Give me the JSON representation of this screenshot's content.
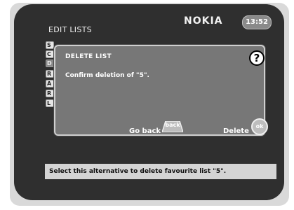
{
  "header": {
    "brand": "NOKIA",
    "time": "13:52",
    "title": "EDIT LISTS"
  },
  "list": {
    "items": [
      "S",
      "C",
      "D",
      "R",
      "A",
      "R",
      "L"
    ],
    "selected_index": 2
  },
  "dialog": {
    "title": "DELETE LIST",
    "help_icon_glyph": "?",
    "message": "Confirm deletion of \"5\".",
    "back_label": "Go back",
    "back_button": "back",
    "delete_label": "Delete",
    "ok_button": "ok"
  },
  "status": {
    "text": "Select this alternative to delete favourite list \"5\"."
  }
}
